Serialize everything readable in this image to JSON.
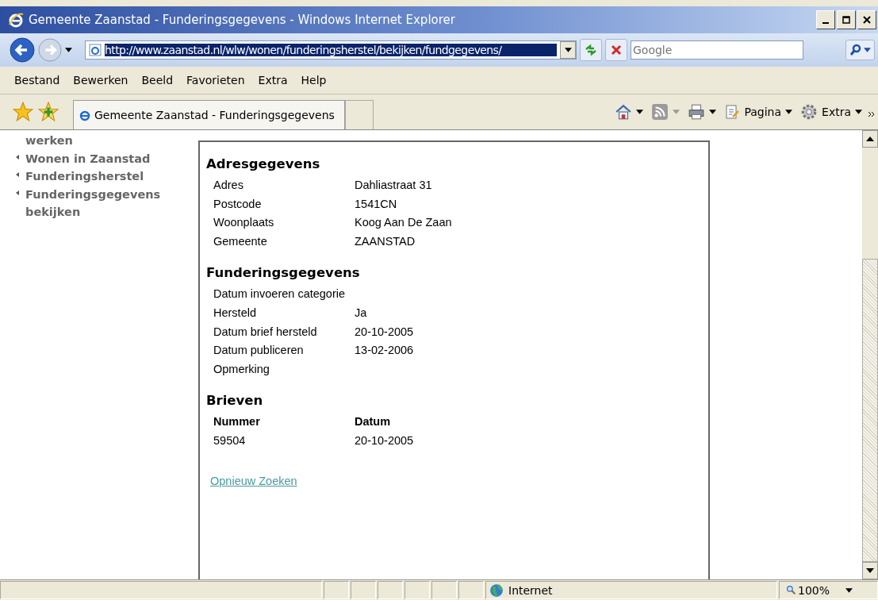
{
  "window": {
    "title": "Gemeente Zaanstad - Funderingsgegevens - Windows Internet Explorer"
  },
  "address_bar": {
    "value": "http://www.zaanstad.nl/wlw/wonen/funderingsherstel/bekijken/fundgegevens/",
    "selected": true
  },
  "search": {
    "placeholder": "Google"
  },
  "menu": [
    {
      "label": "Bestand"
    },
    {
      "label": "Bewerken"
    },
    {
      "label": "Beeld"
    },
    {
      "label": "Favorieten"
    },
    {
      "label": "Extra"
    },
    {
      "label": "Help"
    }
  ],
  "tabs": [
    {
      "label": "Gemeente Zaanstad - Funderingsgegevens",
      "selected": true
    }
  ],
  "command_bar": [
    {
      "kind": "home"
    },
    {
      "kind": "feeds"
    },
    {
      "kind": "print"
    },
    {
      "kind": "page",
      "label": "Pagina"
    },
    {
      "kind": "tools",
      "label": "Extra"
    }
  ],
  "sidebar": {
    "items": [
      {
        "kind": "continuation",
        "text": "werken"
      },
      {
        "kind": "link",
        "text": "Wonen in Zaanstad"
      },
      {
        "kind": "link",
        "text": "Funderingsherstel"
      },
      {
        "kind": "link",
        "text": "Funderingsgegevens bekijken"
      }
    ]
  },
  "sections": [
    {
      "heading": "Adresgegevens",
      "rows": [
        {
          "label": "Adres",
          "value": "Dahliastraat 31"
        },
        {
          "label": "Postcode",
          "value": "1541CN"
        },
        {
          "label": "Woonplaats",
          "value": "Koog Aan De Zaan"
        },
        {
          "label": "Gemeente",
          "value": "ZAANSTAD"
        }
      ]
    },
    {
      "heading": "Funderingsgegevens",
      "rows": [
        {
          "label": "Datum invoeren categorie"
        },
        {
          "label": "Hersteld",
          "value": "Ja"
        },
        {
          "label": "Datum brief hersteld",
          "value": "20-10-2005"
        },
        {
          "label": "Datum publiceren",
          "value": "13-02-2006"
        },
        {
          "label": "Opmerking"
        }
      ]
    }
  ],
  "letters": {
    "heading": "Brieven",
    "columns": [
      "Nummer",
      "Datum"
    ],
    "rows": [
      [
        "59504",
        "20-10-2005"
      ]
    ]
  },
  "link": "Opnieuw Zoeken",
  "status_bar": {
    "zone": "Internet",
    "zoom": "100%"
  }
}
